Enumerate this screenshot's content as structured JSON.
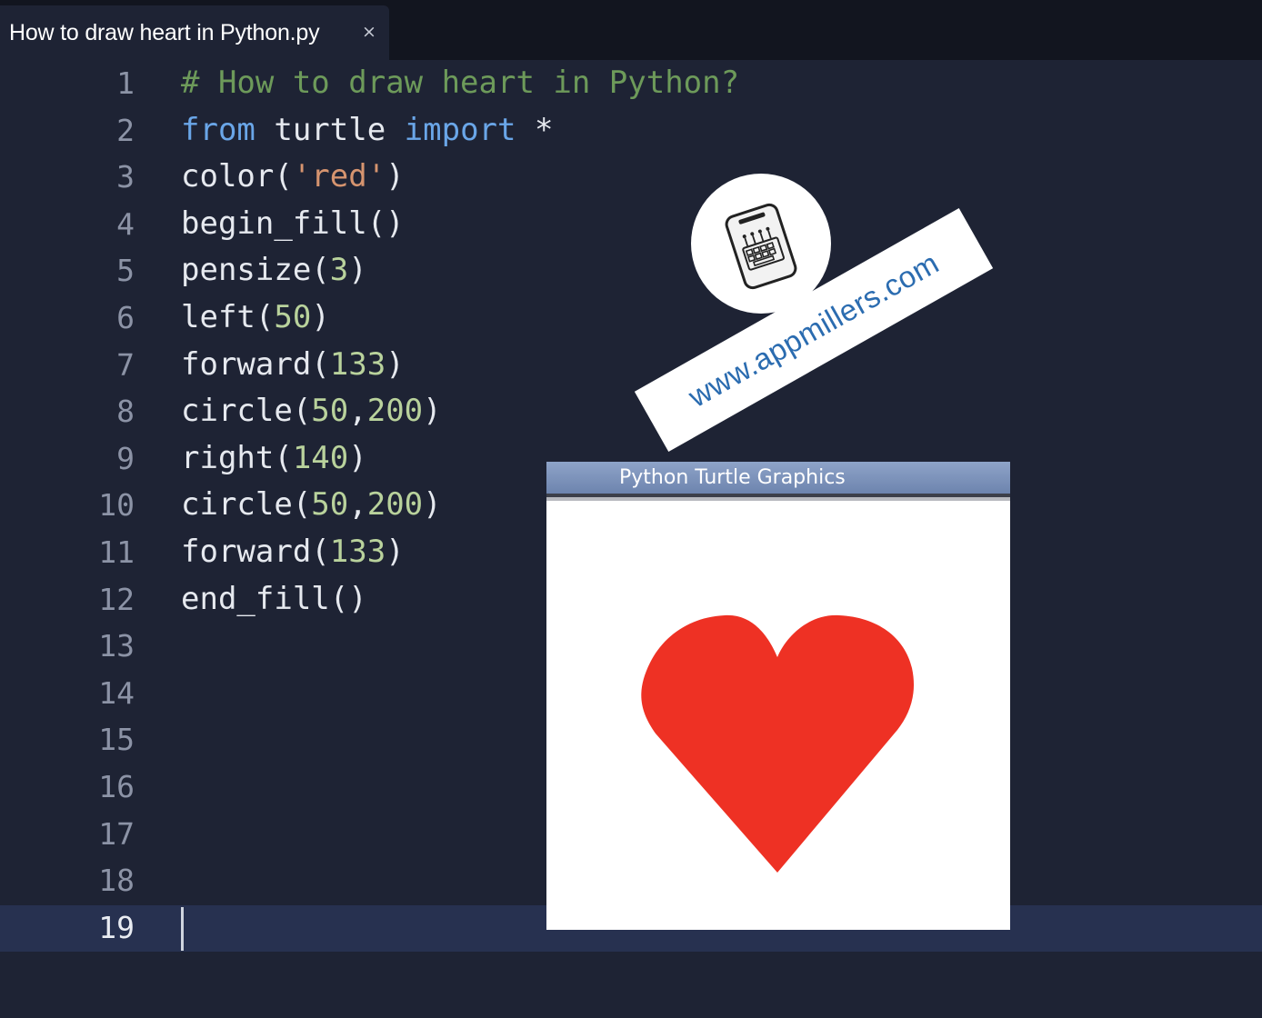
{
  "tab": {
    "title": "How to draw heart in Python.py",
    "close": "×"
  },
  "editor": {
    "lines": [
      {
        "number": "1",
        "tokens": [
          {
            "text": "# How to draw heart in Python?",
            "type": "comment"
          }
        ]
      },
      {
        "number": "2",
        "tokens": [
          {
            "text": "from",
            "type": "keyword"
          },
          {
            "text": " turtle ",
            "type": "plain"
          },
          {
            "text": "import",
            "type": "keyword"
          },
          {
            "text": " *",
            "type": "plain"
          }
        ]
      },
      {
        "number": "3",
        "tokens": [
          {
            "text": "color(",
            "type": "plain"
          },
          {
            "text": "'red'",
            "type": "string"
          },
          {
            "text": ")",
            "type": "plain"
          }
        ]
      },
      {
        "number": "4",
        "tokens": [
          {
            "text": "begin_fill()",
            "type": "plain"
          }
        ]
      },
      {
        "number": "5",
        "tokens": [
          {
            "text": "pensize(",
            "type": "plain"
          },
          {
            "text": "3",
            "type": "number"
          },
          {
            "text": ")",
            "type": "plain"
          }
        ]
      },
      {
        "number": "6",
        "tokens": [
          {
            "text": "left(",
            "type": "plain"
          },
          {
            "text": "50",
            "type": "number"
          },
          {
            "text": ")",
            "type": "plain"
          }
        ]
      },
      {
        "number": "7",
        "tokens": [
          {
            "text": "forward(",
            "type": "plain"
          },
          {
            "text": "133",
            "type": "number"
          },
          {
            "text": ")",
            "type": "plain"
          }
        ]
      },
      {
        "number": "8",
        "tokens": [
          {
            "text": "circle(",
            "type": "plain"
          },
          {
            "text": "50",
            "type": "number"
          },
          {
            "text": ",",
            "type": "plain"
          },
          {
            "text": "200",
            "type": "number"
          },
          {
            "text": ")",
            "type": "plain"
          }
        ]
      },
      {
        "number": "9",
        "tokens": [
          {
            "text": "right(",
            "type": "plain"
          },
          {
            "text": "140",
            "type": "number"
          },
          {
            "text": ")",
            "type": "plain"
          }
        ]
      },
      {
        "number": "10",
        "tokens": [
          {
            "text": "circle(",
            "type": "plain"
          },
          {
            "text": "50",
            "type": "number"
          },
          {
            "text": ",",
            "type": "plain"
          },
          {
            "text": "200",
            "type": "number"
          },
          {
            "text": ")",
            "type": "plain"
          }
        ]
      },
      {
        "number": "11",
        "tokens": [
          {
            "text": "forward(",
            "type": "plain"
          },
          {
            "text": "133",
            "type": "number"
          },
          {
            "text": ")",
            "type": "plain"
          }
        ]
      },
      {
        "number": "12",
        "tokens": [
          {
            "text": "end_fill()",
            "type": "plain"
          }
        ]
      },
      {
        "number": "13",
        "tokens": []
      },
      {
        "number": "14",
        "tokens": []
      },
      {
        "number": "15",
        "tokens": []
      },
      {
        "number": "16",
        "tokens": []
      },
      {
        "number": "17",
        "tokens": []
      },
      {
        "number": "18",
        "tokens": []
      },
      {
        "number": "19",
        "tokens": [],
        "active": true
      }
    ]
  },
  "watermark": {
    "url": "www.appmillers.com",
    "icon": "keyboard-phone-logo-icon"
  },
  "turtle_window": {
    "title": "Python Turtle Graphics",
    "shape": "heart-shape",
    "fill_color": "#ee3124"
  },
  "colors": {
    "background": "#1e2334",
    "comment": "#6d9a5a",
    "keyword": "#6aa6e8",
    "string": "#d6946f",
    "number": "#b9d29c",
    "text": "#e6e9ef",
    "line_number": "#8c93a6",
    "active_line": "#273150",
    "banner_text": "#2b6cb0"
  }
}
